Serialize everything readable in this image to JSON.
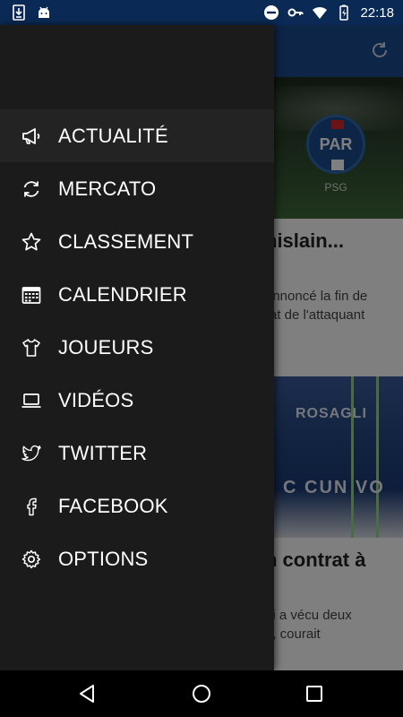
{
  "status_bar": {
    "time": "22:18",
    "left_icons": [
      "download-icon",
      "android-icon"
    ],
    "right_icons": [
      "do-not-disturb-icon",
      "key-icon",
      "wifi-icon",
      "battery-icon"
    ]
  },
  "background_app": {
    "team": {
      "badge_text": "PAR",
      "name": "PSG"
    },
    "articles": [
      {
        "title": "hislain...",
        "snippet_lines": [
          "annoncé la fin de",
          "rat de l'attaquant"
        ]
      },
      {
        "title": "n contrat à",
        "snippet_lines": [
          "ui a vécu deux",
          "é, courait"
        ]
      }
    ],
    "banner_texts": [
      "ROSAGLI",
      "C CUN VO"
    ]
  },
  "drawer": {
    "items": [
      {
        "label": "ACTUALITÉ",
        "icon": "megaphone-icon",
        "active": true
      },
      {
        "label": "MERCATO",
        "icon": "sync-icon",
        "active": false
      },
      {
        "label": "CLASSEMENT",
        "icon": "star-icon",
        "active": false
      },
      {
        "label": "CALENDRIER",
        "icon": "calendar-icon",
        "active": false
      },
      {
        "label": "JOUEURS",
        "icon": "tshirt-icon",
        "active": false
      },
      {
        "label": "VIDÉOS",
        "icon": "laptop-icon",
        "active": false
      },
      {
        "label": "TWITTER",
        "icon": "twitter-icon",
        "active": false
      },
      {
        "label": "FACEBOOK",
        "icon": "facebook-icon",
        "active": false
      },
      {
        "label": "OPTIONS",
        "icon": "gear-icon",
        "active": false
      }
    ]
  },
  "nav_bar": {
    "buttons": [
      "back-icon",
      "home-icon",
      "recents-icon"
    ]
  },
  "colors": {
    "drawer_bg": "#1b1b1b",
    "toolbar_bg": "#1b4b8f",
    "status_bar_bg": "#0a2a55"
  }
}
